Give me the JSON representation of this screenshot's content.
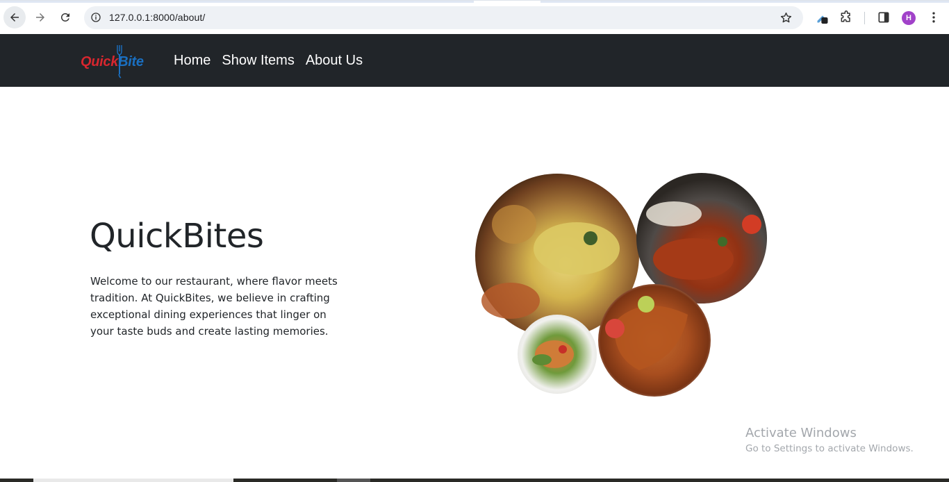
{
  "browser": {
    "url": "127.0.0.1:8000/about/",
    "profile_initial": "H",
    "icons": {
      "back": "arrow-left-icon",
      "forward": "arrow-right-icon",
      "reload": "reload-icon",
      "site_info": "info-icon",
      "bookmark": "star-icon",
      "extension_pen": "pen-extension-icon",
      "extensions": "puzzle-icon",
      "side_panel": "side-panel-icon",
      "menu": "kebab-menu-icon"
    },
    "colors": {
      "omnibox_bg": "#eef1f5",
      "avatar_bg": "#a142c9"
    }
  },
  "navbar": {
    "logo": {
      "part1": "Quick",
      "part2": "Bite",
      "color1": "#d7262e",
      "color2": "#1a6fc0"
    },
    "links": [
      {
        "label": "Home"
      },
      {
        "label": "Show Items"
      },
      {
        "label": "About Us"
      }
    ],
    "background": "#212529"
  },
  "hero": {
    "title": "QuickBites",
    "description": "Welcome to our restaurant, where flavor meets tradition. At QuickBites, we believe in crafting exceptional dining experiences that linger on your taste buds and create lasting memories."
  },
  "collage": {
    "images": [
      "biryani-bowl-image",
      "curry-kadai-image",
      "grilled-chicken-image",
      "salad-plate-image"
    ]
  },
  "watermark": {
    "title": "Activate Windows",
    "subtitle": "Go to Settings to activate Windows."
  }
}
